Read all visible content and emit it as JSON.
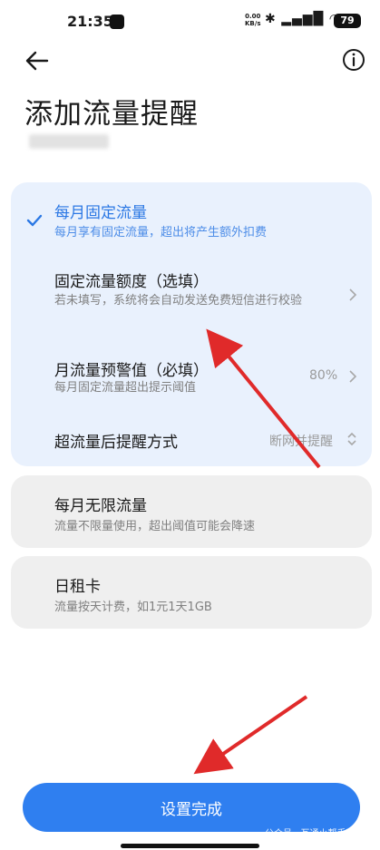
{
  "status_bar": {
    "time": "21:35",
    "speed_value": "0.00",
    "speed_unit": "KB/s",
    "battery": "79"
  },
  "header": {
    "title": "添加流量提醒"
  },
  "options": {
    "fixed": {
      "title": "每月固定流量",
      "desc": "每月享有固定流量，超出将产生额外扣费",
      "quota_title": "固定流量额度（选填）",
      "quota_desc": "若未填写，系统将会自动发送免费短信进行校验",
      "warning_title": "月流量预警值（必填）",
      "warning_desc": "每月固定流量超出提示阈值",
      "warning_value": "80%",
      "reminder_title": "超流量后提醒方式",
      "reminder_value": "断网并提醒"
    },
    "unlimited": {
      "title": "每月无限流量",
      "desc": "流量不限量使用，超出阈值可能会降速"
    },
    "daily": {
      "title": "日租卡",
      "desc": "流量按天计费，如1元1天1GB"
    }
  },
  "footer": {
    "confirm_label": "设置完成",
    "watermark": "公众号 · 互通小帮手"
  },
  "colors": {
    "accent": "#2f7ff0",
    "selected_card": "#e9f1fd",
    "annotation_arrow": "#e02a2a"
  }
}
